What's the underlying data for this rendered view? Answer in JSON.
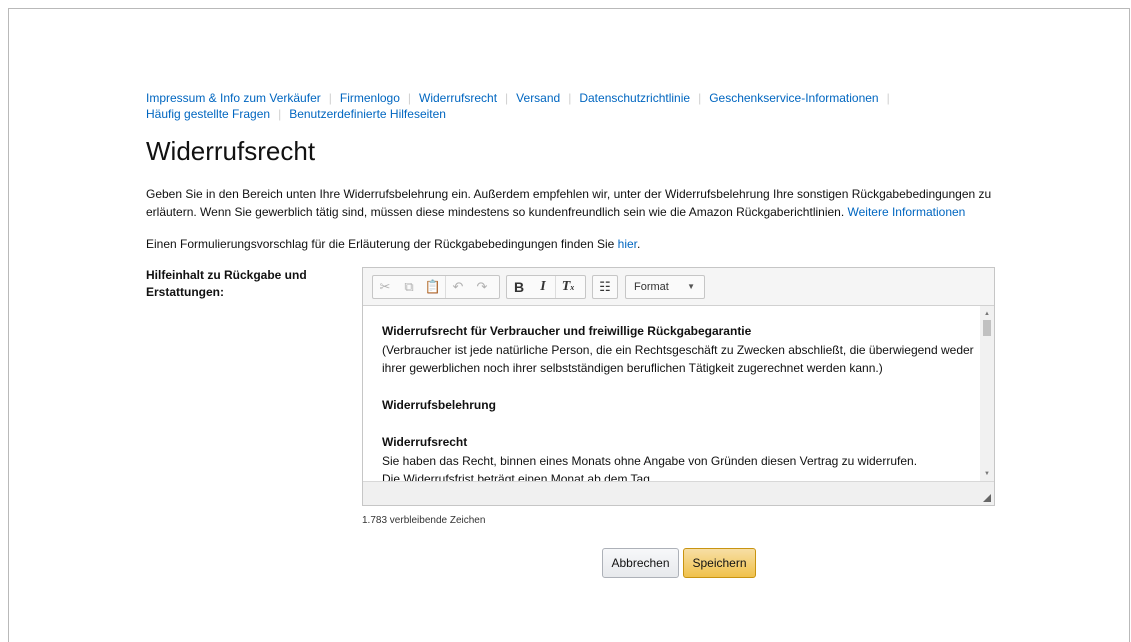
{
  "nav": {
    "links": [
      "Impressum & Info zum Verkäufer",
      "Firmenlogo",
      "Widerrufsrecht",
      "Versand",
      "Datenschutzrichtlinie",
      "Geschenkservice-Informationen",
      "Häufig gestellte Fragen",
      "Benutzerdefinierte Hilfeseiten"
    ]
  },
  "page": {
    "title": "Widerrufsrecht",
    "intro": "Geben Sie in den Bereich unten Ihre Widerrufsbelehrung ein. Außerdem empfehlen wir, unter der Widerrufsbelehrung Ihre sonstigen Rückgabebedingungen zu erläutern. Wenn Sie gewerblich tätig sind, müssen diese mindestens so kundenfreundlich sein wie die Amazon Rückgaberichtlinien.",
    "intro_link": "Weitere Informationen",
    "hint_text": "Einen Formulierungsvorschlag für die Erläuterung der Rückgabebedingungen finden Sie",
    "hint_link": "hier",
    "hint_end": "."
  },
  "form": {
    "label": "Hilfeinhalt zu Rückgabe und Erstattungen:",
    "remaining": "1.783 verbleibende Zeichen"
  },
  "editor": {
    "format_label": "Format",
    "toolbar_icons": [
      "cut-icon",
      "copy-icon",
      "paste-icon",
      "undo-icon",
      "redo-icon",
      "bold-icon",
      "italic-icon",
      "remove-format-icon",
      "bulleted-list-icon"
    ],
    "content": {
      "heading": "Widerrufsrecht für Verbraucher und freiwillige Rückgabegarantie",
      "para1": "(Verbraucher ist jede natürliche Person, die ein Rechtsgeschäft zu Zwecken abschließt, die überwiegend weder ihrer gewerblichen noch ihrer selbstständigen beruflichen Tätigkeit zugerechnet werden kann.)",
      "heading2": "Widerrufsbelehrung",
      "heading3": "Widerrufsrecht",
      "para2": "Sie haben das Recht, binnen eines Monats ohne Angabe von Gründen diesen Vertrag zu widerrufen.",
      "para3": "Die Widerrufsfrist beträgt einen Monat ab dem Tag,"
    }
  },
  "buttons": {
    "cancel": "Abbrechen",
    "save": "Speichern"
  },
  "colors": {
    "link": "#0066c0",
    "save_button": "#f0c14b"
  }
}
